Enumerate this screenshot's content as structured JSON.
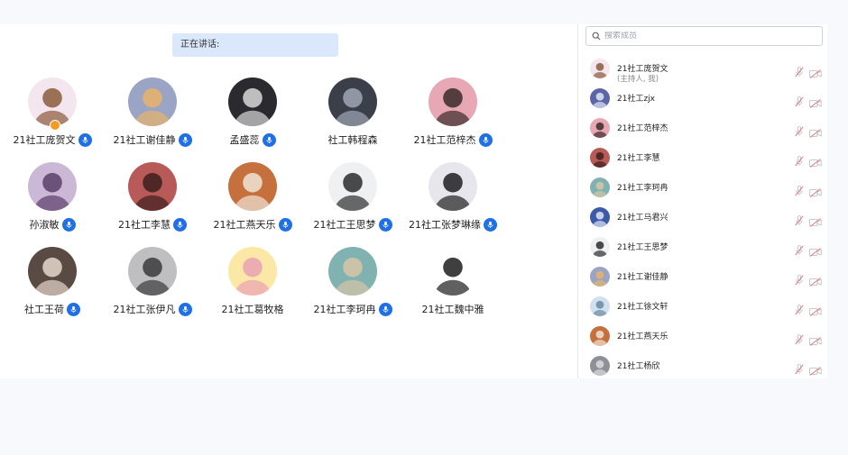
{
  "main": {
    "speaking_label": "正在讲话:",
    "participants": [
      {
        "name": "21社工庞贺文",
        "mic": true,
        "host": true,
        "avatar": "anime-girl-brown-hair",
        "bg": "#f3e6ef",
        "fg": "#8a5a3c"
      },
      {
        "name": "21社工谢佳静",
        "mic": true,
        "avatar": "blurry-photo",
        "bg": "#9aa4c4",
        "fg": "#e8b36a"
      },
      {
        "name": "孟盛蕊",
        "mic": true,
        "avatar": "dark-portrait",
        "bg": "#2b2b2f",
        "fg": "#d8d8d8"
      },
      {
        "name": "社工韩程森",
        "mic": false,
        "avatar": "night-street",
        "bg": "#3b3f4a",
        "fg": "#a0a6b4"
      },
      {
        "name": "21社工范梓杰",
        "mic": true,
        "avatar": "anime-girl-pink",
        "bg": "#e7a7b5",
        "fg": "#3a2a2a"
      },
      {
        "name": "孙淑敏",
        "mic": true,
        "avatar": "anime-girl-purple",
        "bg": "#cbb8d6",
        "fg": "#5b3f6b"
      },
      {
        "name": "21社工李慧",
        "mic": true,
        "avatar": "red-hair-girl",
        "bg": "#b85a57",
        "fg": "#3d1e1e"
      },
      {
        "name": "21社工燕天乐",
        "mic": true,
        "avatar": "cat-photo",
        "bg": "#c6703d",
        "fg": "#eee4d6"
      },
      {
        "name": "21社工王思梦",
        "mic": true,
        "avatar": "woman-portrait",
        "bg": "#eef0f2",
        "fg": "#2c2c2c"
      },
      {
        "name": "21社工张梦琳缘",
        "mic": true,
        "avatar": "man-beanie",
        "bg": "#e6e6ec",
        "fg": "#1f1f22"
      },
      {
        "name": "社工王荷",
        "mic": true,
        "avatar": "woman-dark",
        "bg": "#5a4a44",
        "fg": "#e7d6cb"
      },
      {
        "name": "21社工张伊凡",
        "mic": true,
        "avatar": "boy-portrait",
        "bg": "#bfbfc2",
        "fg": "#3a3a3c"
      },
      {
        "name": "21社工葛牧格",
        "mic": false,
        "avatar": "cartoon-dog",
        "bg": "#fbe7a6",
        "fg": "#e9a2b4"
      },
      {
        "name": "21社工李珂冉",
        "mic": true,
        "avatar": "woman-sunglasses",
        "bg": "#7fb2b0",
        "fg": "#d8c5a7"
      },
      {
        "name": "21社工魏中雅",
        "mic": false,
        "avatar": "kuromi-cartoon",
        "bg": "#ffffff",
        "fg": "#1d1d1d"
      }
    ]
  },
  "sidebar": {
    "search_placeholder": "搜索成员",
    "members": [
      {
        "name": "21社工庞贺文",
        "sub": "(主持人, 我)",
        "bg": "#f3e6ef",
        "fg": "#8a5a3c"
      },
      {
        "name": "21社工zjx",
        "sub": "",
        "bg": "#5a66a8",
        "fg": "#e3e6f4"
      },
      {
        "name": "21社工范梓杰",
        "sub": "",
        "bg": "#e7a7b5",
        "fg": "#3a2a2a"
      },
      {
        "name": "21社工李慧",
        "sub": "",
        "bg": "#b85a57",
        "fg": "#3d1e1e"
      },
      {
        "name": "21社工李珂冉",
        "sub": "",
        "bg": "#7fb2b0",
        "fg": "#d8c5a7"
      },
      {
        "name": "21社工马君兴",
        "sub": "",
        "bg": "#3c5aa8",
        "fg": "#dfe6f4"
      },
      {
        "name": "21社工王思梦",
        "sub": "",
        "bg": "#eef0f2",
        "fg": "#2c2c2c"
      },
      {
        "name": "21社工谢佳静",
        "sub": "",
        "bg": "#9aa4c4",
        "fg": "#e8b36a"
      },
      {
        "name": "21社工徐文轩",
        "sub": "",
        "bg": "#cfe1ee",
        "fg": "#6c8aa3"
      },
      {
        "name": "21社工燕天乐",
        "sub": "",
        "bg": "#c6703d",
        "fg": "#eee4d6"
      },
      {
        "name": "21社工杨欣",
        "sub": "",
        "bg": "#8e9096",
        "fg": "#dadbe0"
      }
    ]
  },
  "colors": {
    "mic_badge": "#1f6fe6",
    "speaking_bg": "#dbe8fb",
    "muted_icon": "#e07a80"
  }
}
